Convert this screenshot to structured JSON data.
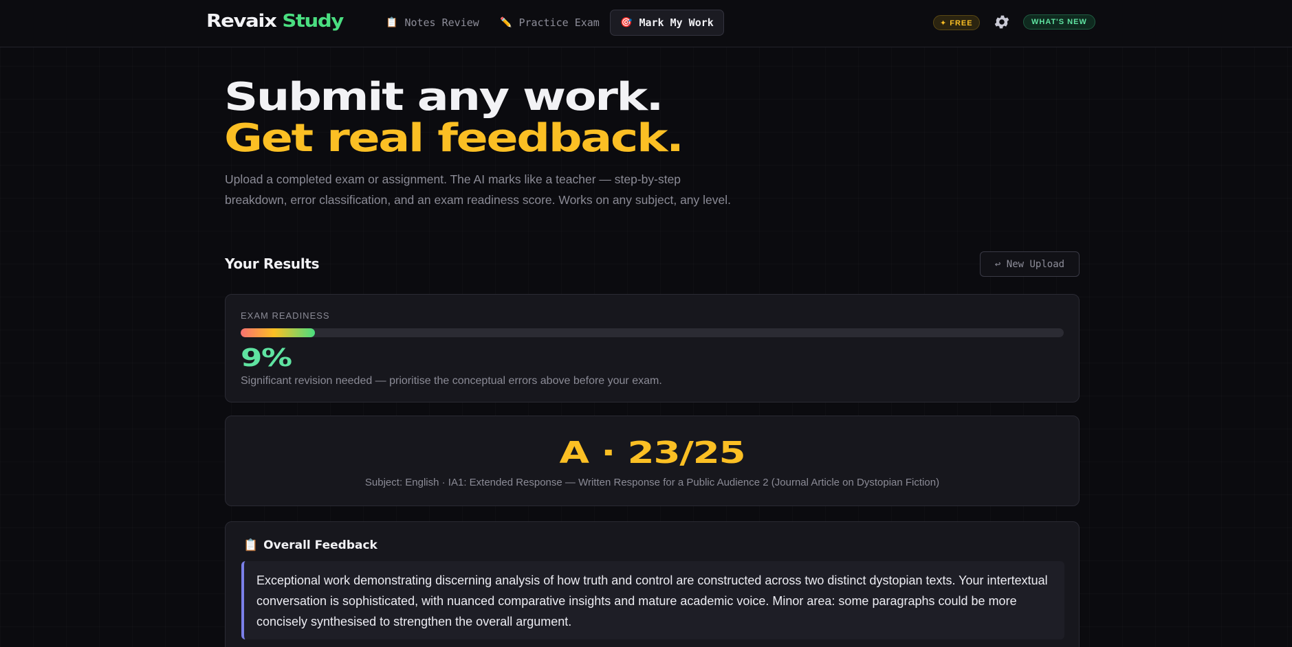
{
  "nav": {
    "logo_main": "Revaix",
    "logo_accent": "Study",
    "links": [
      {
        "icon": "notepad-icon",
        "glyph": "📋",
        "label": "Notes Review"
      },
      {
        "icon": "pencil-icon",
        "glyph": "✏️",
        "label": "Practice Exam"
      },
      {
        "icon": "target-icon",
        "glyph": "🎯",
        "label": "Mark My Work"
      }
    ],
    "free_badge": "✦ FREE",
    "whats_new": "WHAT'S NEW"
  },
  "hero": {
    "line1": "Submit any work.",
    "line2": "Get real feedback.",
    "subtitle": "Upload a completed exam or assignment. The AI marks like a teacher — step-by-step breakdown, error classification, and an exam readiness score. Works on any subject, any level."
  },
  "results": {
    "title": "Your Results",
    "new_upload_label": "↩ New Upload",
    "readiness": {
      "label": "EXAM READINESS",
      "percent": 9,
      "percent_text": "9%",
      "note": "Significant revision needed — prioritise the conceptual errors above before your exam."
    },
    "grade": {
      "text": "A · 23/25",
      "subject": "Subject: English · IA1: Extended Response — Written Response for a Public Audience 2 (Journal Article on Dystopian Fiction)"
    },
    "feedback": {
      "title": "Overall Feedback",
      "icon": "clipboard-icon",
      "glyph": "📋",
      "text": "Exceptional work demonstrating discerning analysis of how truth and control are constructed across two distinct dystopian texts. Your intertextual conversation is sophisticated, with nuanced comparative insights and mature academic voice. Minor area: some paragraphs could be more concisely synthesised to strengthen the overall argument."
    }
  },
  "colors": {
    "accent_yellow": "#fbbf24",
    "accent_green": "#4ade80",
    "readiness_green": "#5fe3a1",
    "feedback_border": "#7b7fe8"
  }
}
